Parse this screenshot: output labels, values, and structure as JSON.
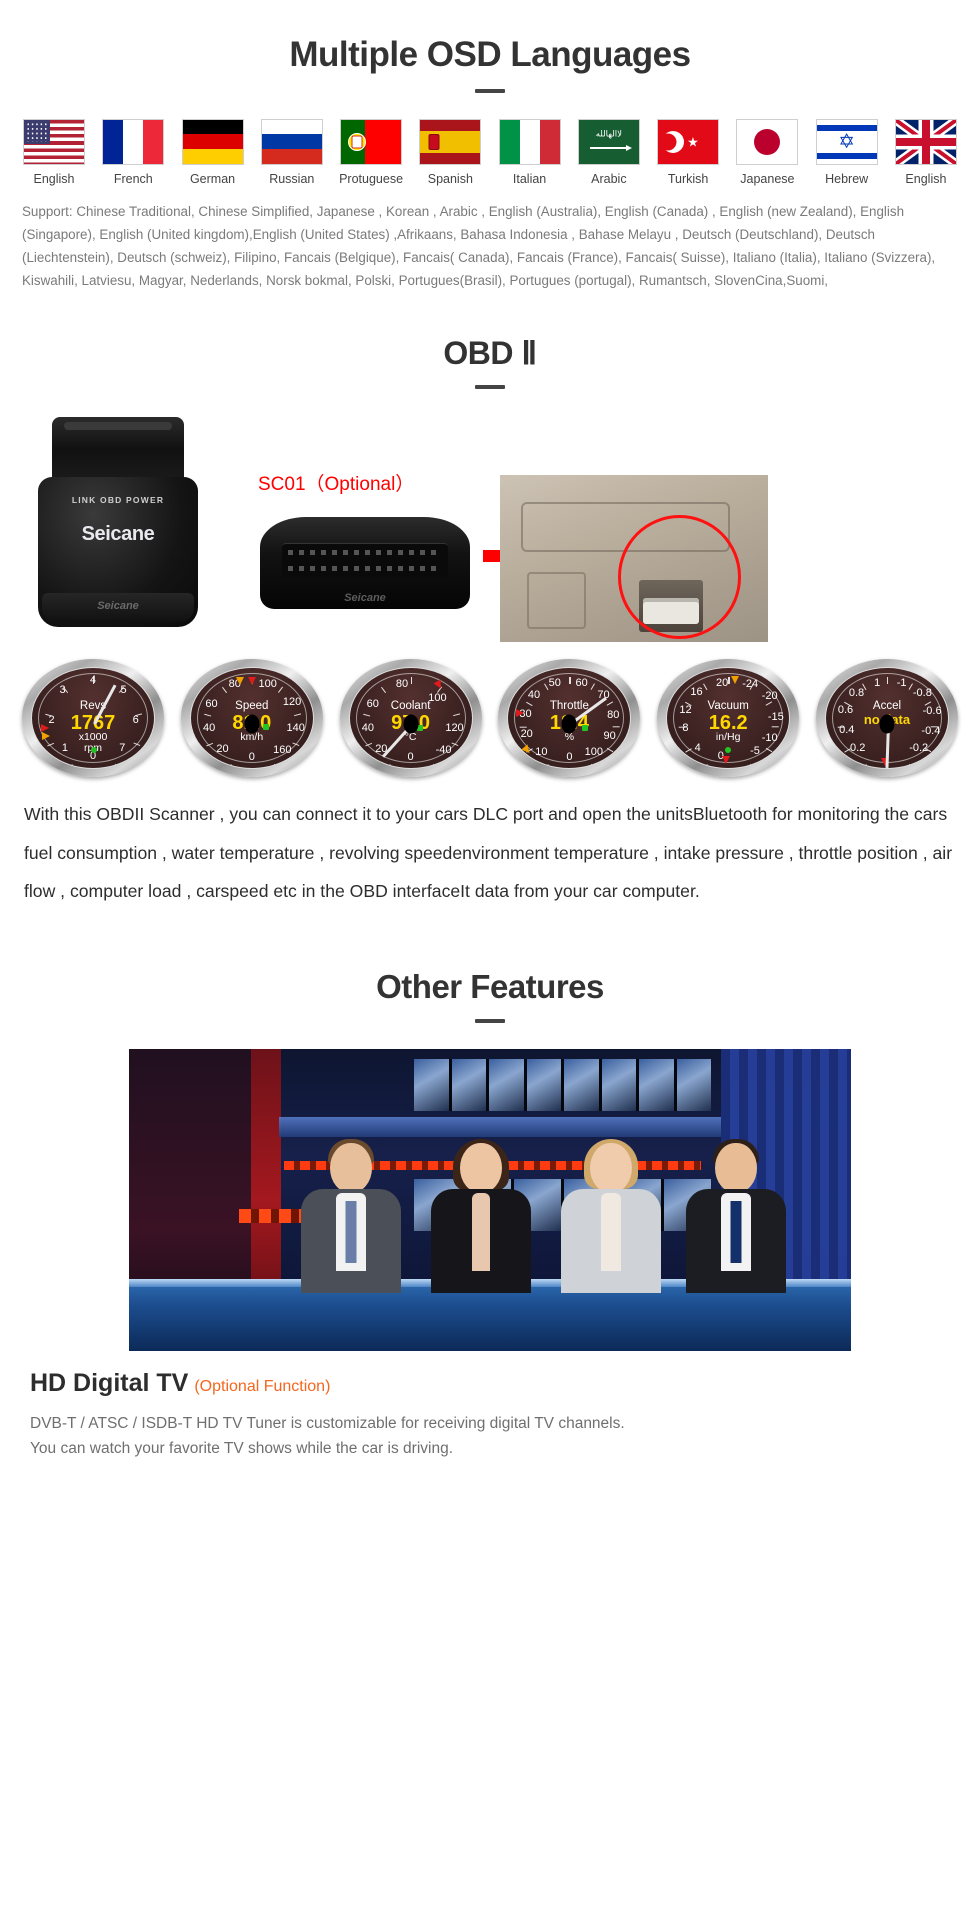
{
  "languages_section": {
    "title": "Multiple OSD Languages",
    "flags": [
      {
        "label": "English",
        "icon": "flag-usa-icon",
        "code": "us"
      },
      {
        "label": "French",
        "icon": "flag-france-icon",
        "code": "fr"
      },
      {
        "label": "German",
        "icon": "flag-germany-icon",
        "code": "de"
      },
      {
        "label": "Russian",
        "icon": "flag-russia-icon",
        "code": "ru"
      },
      {
        "label": "Protuguese",
        "icon": "flag-portugal-icon",
        "code": "pt"
      },
      {
        "label": "Spanish",
        "icon": "flag-spain-icon",
        "code": "es"
      },
      {
        "label": "Italian",
        "icon": "flag-italy-icon",
        "code": "it"
      },
      {
        "label": "Arabic",
        "icon": "flag-saudi-arabia-icon",
        "code": "sa"
      },
      {
        "label": "Turkish",
        "icon": "flag-turkey-icon",
        "code": "tr"
      },
      {
        "label": "Japanese",
        "icon": "flag-japan-icon",
        "code": "jp"
      },
      {
        "label": "Hebrew",
        "icon": "flag-israel-icon",
        "code": "il"
      },
      {
        "label": "English",
        "icon": "flag-uk-icon",
        "code": "uk"
      }
    ],
    "support_text": "Support: Chinese Traditional, Chinese Simplified, Japanese , Korean , Arabic , English (Australia), English (Canada) , English (new Zealand), English (Singapore), English (United kingdom),English (United States) ,Afrikaans, Bahasa Indonesia , Bahase Melayu , Deutsch (Deutschland), Deutsch (Liechtenstein), Deutsch (schweiz), Filipino, Fancais (Belgique), Fancais( Canada), Fancais (France), Fancais( Suisse), Italiano (Italia), Italiano (Svizzera), Kiswahili, Latviesu, Magyar, Nederlands, Norsk bokmal, Polski, Portugues(Brasil), Portugues (portugal), Rumantsch, SlovenCina,Suomi,"
  },
  "obd_section": {
    "title": "OBD Ⅱ",
    "dongle_lamps": "LINK  OBD  POWER",
    "dongle_brand": "Seicane",
    "dongle_foot_brand": "Seicane",
    "connector_brand": "Seicane",
    "sc01_label": "SC01（Optional）",
    "arrow_icon": "red-right-arrow-icon",
    "car_photo_alt": "car-dlc-port-photo",
    "description": "With this OBDII Scanner , you can connect it to your cars DLC port and open the unitsBluetooth for monitoring the cars fuel consumption , water temperature , revolving speedenvironment temperature , intake pressure , throttle position , air flow , computer load , carspeed etc in the OBD interfaceIt data from your car computer."
  },
  "gauges": [
    {
      "name": "Revs",
      "value": "1767",
      "unit": "x1000\nrpm",
      "nums": [
        "0",
        "1",
        "2",
        "3",
        "4",
        "5",
        "6",
        "7"
      ],
      "needle_deg": -152,
      "value_color": "#ffd700"
    },
    {
      "name": "Speed",
      "value": "81.0",
      "unit": "km/h",
      "nums": [
        "0",
        "20",
        "40",
        "60",
        "80",
        "100",
        "120",
        "140",
        "160"
      ],
      "needle_deg": 28,
      "value_color": "#ffd700"
    },
    {
      "name": "Coolant",
      "value": "97.0",
      "unit": "°C",
      "nums": [
        "-40",
        "0",
        "20",
        "40",
        "60",
        "80",
        "100",
        "120"
      ],
      "needle_deg": 42,
      "value_color": "#ffd700"
    },
    {
      "name": "Throttle",
      "value": "18.4",
      "unit": "%",
      "nums": [
        "0",
        "10",
        "20",
        "30",
        "40",
        "50",
        "60",
        "70",
        "80",
        "90",
        "100"
      ],
      "needle_deg": -126,
      "value_color": "#ffd700"
    },
    {
      "name": "Vacuum",
      "value": "16.2",
      "unit": "in/Hg",
      "nums": [
        "0",
        "4",
        "8",
        "12",
        "16",
        "20",
        "-24",
        "-20",
        "-15",
        "-10",
        "-5"
      ],
      "needle_deg": 150,
      "value_color": "#ffd700"
    },
    {
      "name": "Accel",
      "value": "no data",
      "unit": "",
      "nums": [
        "0.2",
        "0.4",
        "0.6",
        "0.8",
        "1",
        "-1",
        "-0.8",
        "-0.6",
        "-0.4",
        "-0.2"
      ],
      "needle_deg": 2,
      "value_color": "#ffd700"
    }
  ],
  "other_features": {
    "title": "Other Features",
    "tv_photo_alt": "tv-news-studio-photo",
    "hd_title": "HD Digital TV",
    "hd_optional": "(Optional Function)",
    "hd_desc_line1": "DVB-T / ATSC / ISDB-T HD TV Tuner is customizable for receiving digital TV channels.",
    "hd_desc_line2": "You can watch your favorite TV shows while the car is driving."
  },
  "colors": {
    "heading": "#333333",
    "muted_text": "#7a7a7a",
    "body_text": "#2d2d2d",
    "accent_red": "#ff0000",
    "accent_orange": "#f5661e",
    "gauge_value": "#ffd700"
  }
}
